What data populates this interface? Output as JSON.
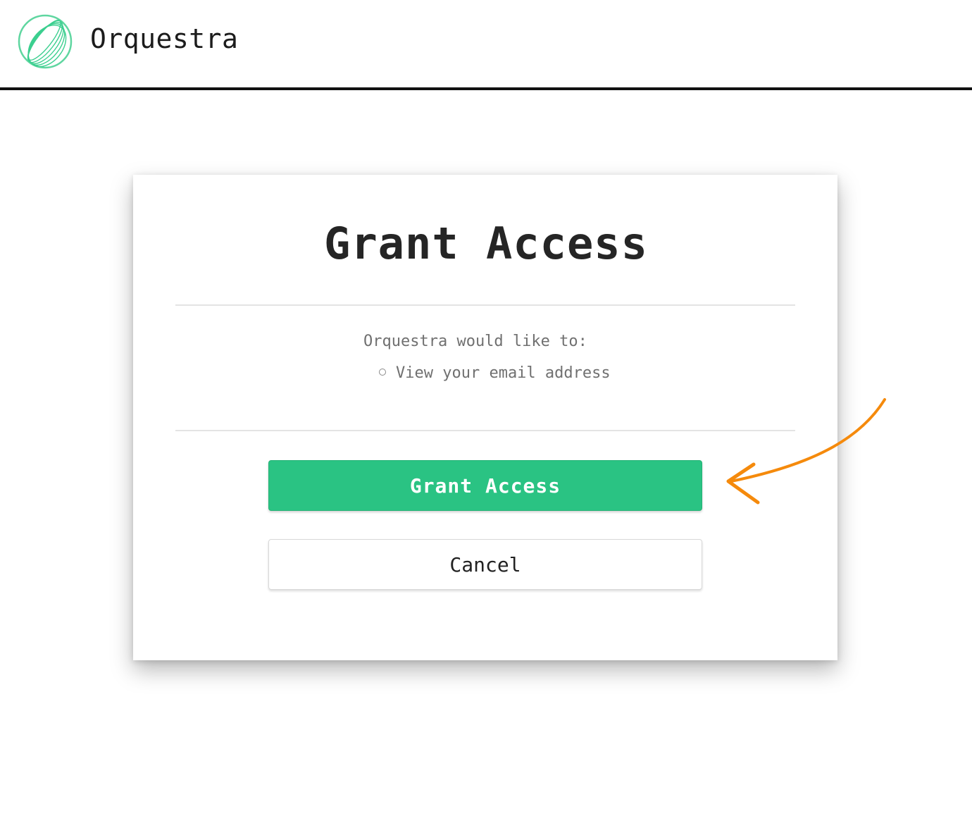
{
  "header": {
    "brand_name": "Orquestra",
    "logo_icon": "orquestra-logo-icon"
  },
  "dialog": {
    "title": "Grant Access",
    "intro": "Orquestra would like to:",
    "permissions": [
      {
        "label": "View your email address"
      }
    ],
    "grant_button_label": "Grant Access",
    "cancel_button_label": "Cancel"
  },
  "annotation": {
    "icon": "arrow-pointer-icon",
    "color": "#f58a0c"
  },
  "colors": {
    "accent": "#2ac383",
    "header_border": "#111111",
    "muted_text": "#707070"
  }
}
